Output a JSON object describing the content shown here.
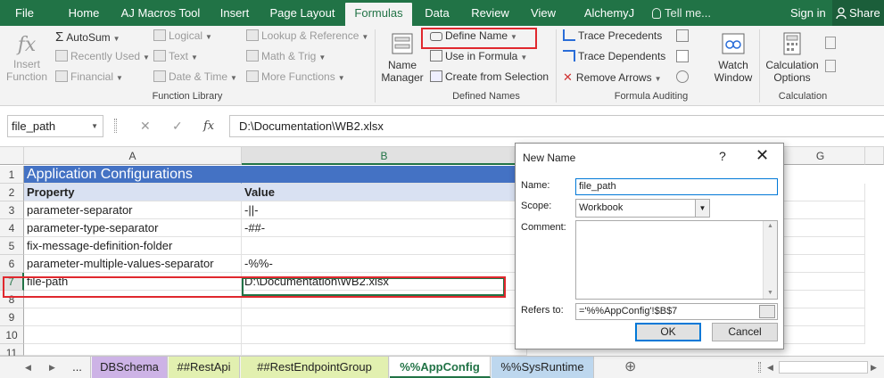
{
  "ribbon_tabs": [
    "File",
    "Home",
    "AJ Macros Tool",
    "Insert",
    "Page Layout",
    "Formulas",
    "Data",
    "Review",
    "View",
    "AlchemyJ"
  ],
  "tell_me": "Tell me...",
  "sign_in": "Sign in",
  "share": "Share",
  "function_library": {
    "insert_function": [
      "Insert",
      "Function"
    ],
    "autosum": "AutoSum",
    "recently_used": "Recently Used",
    "financial": "Financial",
    "logical": "Logical",
    "text": "Text",
    "date_time": "Date & Time",
    "lookup_reference": "Lookup & Reference",
    "math_trig": "Math & Trig",
    "more_functions": "More Functions",
    "group_label": "Function Library"
  },
  "defined_names": {
    "name_manager": [
      "Name",
      "Manager"
    ],
    "define_name": "Define Name",
    "use_in_formula": "Use in Formula",
    "create_from_selection": "Create from Selection",
    "group_label": "Defined Names"
  },
  "formula_auditing": {
    "trace_precedents": "Trace Precedents",
    "trace_dependents": "Trace Dependents",
    "remove_arrows": "Remove Arrows",
    "watch_window": [
      "Watch",
      "Window"
    ],
    "group_label": "Formula Auditing"
  },
  "calculation": {
    "calculation_options": [
      "Calculation",
      "Options"
    ],
    "group_label": "Calculation"
  },
  "formula_bar": {
    "name_box": "file_path",
    "cancel": "✕",
    "enter": "✓",
    "fx": "fx",
    "formula": "D:\\Documentation\\WB2.xlsx"
  },
  "columns": [
    "A",
    "B",
    "G"
  ],
  "rows": [
    "1",
    "2",
    "3",
    "4",
    "5",
    "6",
    "7",
    "8",
    "9",
    "10",
    "11"
  ],
  "sheet": {
    "title": "Application Configurations",
    "header": {
      "property": "Property",
      "value": "Value"
    },
    "data": [
      {
        "property": "parameter-separator",
        "value": "-||-"
      },
      {
        "property": "parameter-type-separator",
        "value": "-##-"
      },
      {
        "property": "fix-message-definition-folder",
        "value": ""
      },
      {
        "property": "parameter-multiple-values-separator",
        "value": "-%%-"
      },
      {
        "property": "file-path",
        "value": "D:\\Documentation\\WB2.xlsx"
      }
    ]
  },
  "sheet_tabs": [
    "...",
    "DBSchema",
    "##RestApi",
    "##RestEndpointGroup",
    "%%AppConfig",
    "%%SysRuntime"
  ],
  "sheet_tab_colors": [
    "#f3f3f3",
    "#cdb3e6",
    "#e2f0b0",
    "#e2f0b0",
    "#ffffff",
    "#bdd7ee"
  ],
  "add_sheet": "⊕",
  "dialog": {
    "title": "New Name",
    "help": "?",
    "close": "✕",
    "name_label": "Name:",
    "name_value": "file_path",
    "scope_label": "Scope:",
    "scope_value": "Workbook",
    "comment_label": "Comment:",
    "refers_label": "Refers to:",
    "refers_value": "='%%AppConfig'!$B$7",
    "ok": "OK",
    "cancel": "Cancel"
  },
  "colors": {
    "excel_green": "#217346",
    "title_fill": "#4472c4",
    "header_fill": "#d9e1f2",
    "highlight_red": "#e0282e"
  }
}
